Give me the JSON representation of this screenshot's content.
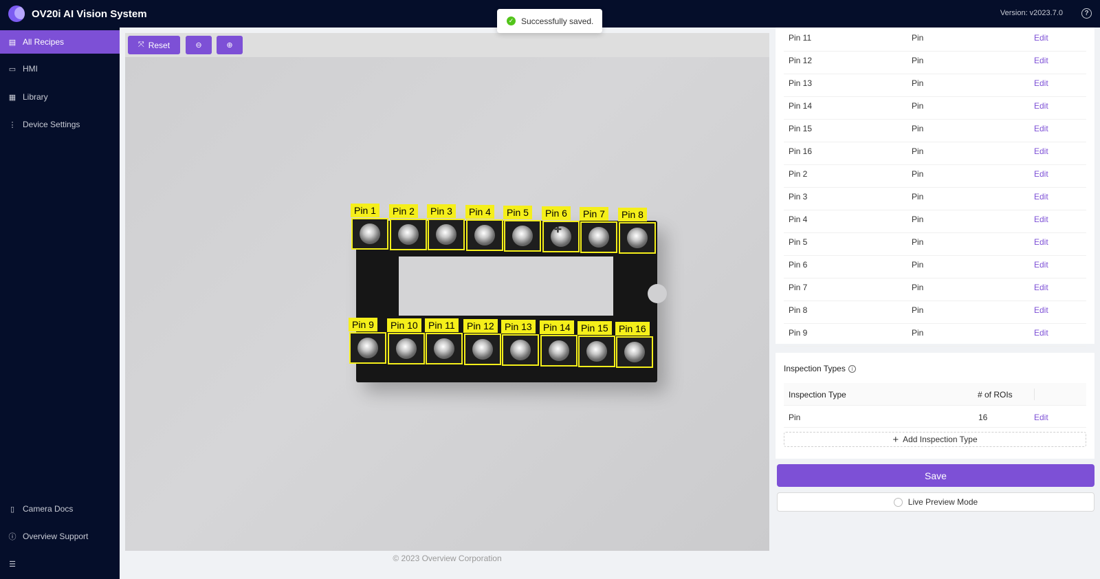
{
  "header": {
    "title": "OV20i AI Vision System",
    "version": "Version: v2023.7.0",
    "help_glyph": "?"
  },
  "toast": {
    "message": "Successfully saved."
  },
  "sidebar": {
    "items": [
      {
        "label": "All Recipes",
        "icon": "recipes-icon",
        "glyph": "▤",
        "active": true
      },
      {
        "label": "HMI",
        "icon": "video-icon",
        "glyph": "▭"
      },
      {
        "label": "Library",
        "icon": "table-icon",
        "glyph": "▦"
      },
      {
        "label": "Device Settings",
        "icon": "settings-icon",
        "glyph": "⋮"
      }
    ],
    "bottom_items": [
      {
        "label": "Camera Docs",
        "icon": "book-icon",
        "glyph": "▯"
      },
      {
        "label": "Overview Support",
        "icon": "info-icon",
        "glyph": "ⓘ"
      }
    ],
    "collapse_glyph": "☰"
  },
  "toolbar": {
    "reset_label": "Reset",
    "reset_glyph": "⤧",
    "zoom_out_glyph": "⊖",
    "zoom_in_glyph": "⊕"
  },
  "image": {
    "pins_top": [
      "Pin 1",
      "Pin 2",
      "Pin 3",
      "Pin 4",
      "Pin 5",
      "Pin 6",
      "Pin 7",
      "Pin 8"
    ],
    "pins_bottom": [
      "Pin 9",
      "Pin 10",
      "Pin 11",
      "Pin 12",
      "Pin 13",
      "Pin 14",
      "Pin 15",
      "Pin 16"
    ],
    "crosshair_glyph": "✛"
  },
  "footer": {
    "copyright": "© 2023 Overview Corporation"
  },
  "roi_table": {
    "edit_label": "Edit",
    "rows": [
      {
        "name": "Pin 11",
        "type": "Pin"
      },
      {
        "name": "Pin 12",
        "type": "Pin"
      },
      {
        "name": "Pin 13",
        "type": "Pin"
      },
      {
        "name": "Pin 14",
        "type": "Pin"
      },
      {
        "name": "Pin 15",
        "type": "Pin"
      },
      {
        "name": "Pin 16",
        "type": "Pin"
      },
      {
        "name": "Pin 2",
        "type": "Pin"
      },
      {
        "name": "Pin 3",
        "type": "Pin"
      },
      {
        "name": "Pin 4",
        "type": "Pin"
      },
      {
        "name": "Pin 5",
        "type": "Pin"
      },
      {
        "name": "Pin 6",
        "type": "Pin"
      },
      {
        "name": "Pin 7",
        "type": "Pin"
      },
      {
        "name": "Pin 8",
        "type": "Pin"
      },
      {
        "name": "Pin 9",
        "type": "Pin"
      }
    ]
  },
  "inspection_types": {
    "title": "Inspection Types",
    "col_type": "Inspection Type",
    "col_rois": "# of ROIs",
    "rows": [
      {
        "type": "Pin",
        "rois": "16",
        "edit": "Edit"
      }
    ],
    "add_label": "Add Inspection Type"
  },
  "actions": {
    "save_label": "Save",
    "live_preview_label": "Live Preview Mode"
  },
  "colors": {
    "accent": "#7d50d6",
    "nav_bg": "#050e2a",
    "roi_yellow": "#f5ef1a",
    "success": "#52c41a"
  }
}
